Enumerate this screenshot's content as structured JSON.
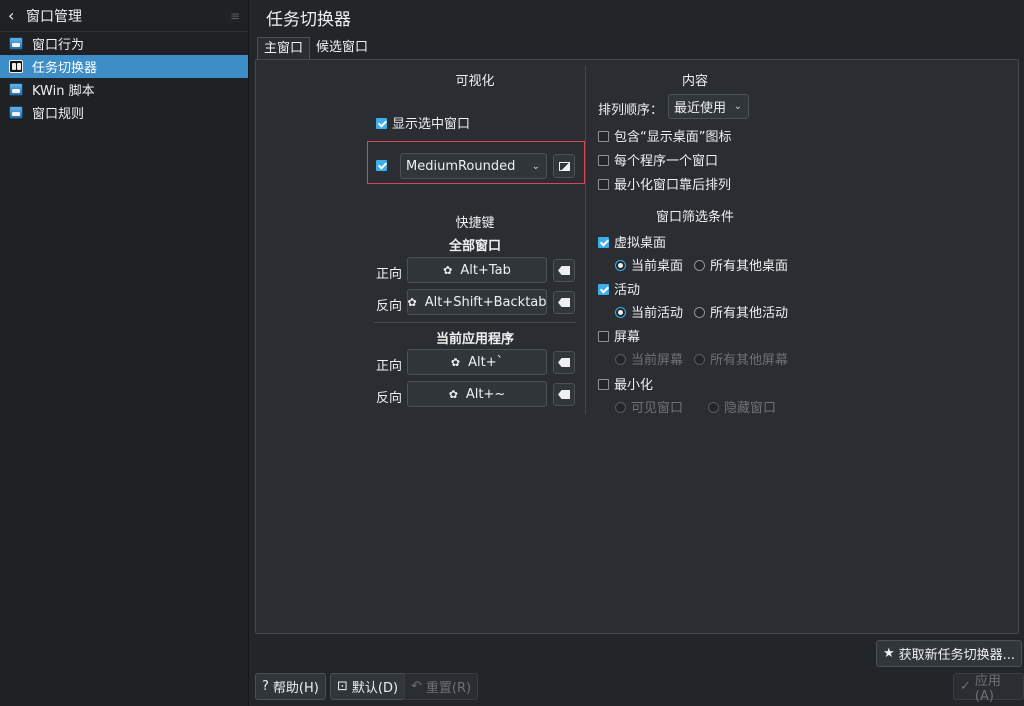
{
  "sidebar": {
    "back_label": "窗口管理",
    "items": [
      {
        "label": "窗口行为",
        "icon": "window-behavior-icon"
      },
      {
        "label": "任务切换器",
        "icon": "task-switcher-icon"
      },
      {
        "label": "KWin 脚本",
        "icon": "kwin-scripts-icon"
      },
      {
        "label": "窗口规则",
        "icon": "window-rules-icon"
      }
    ]
  },
  "header": {
    "title": "任务切换器"
  },
  "tabs": [
    {
      "label": "主窗口"
    },
    {
      "label": "候选窗口"
    }
  ],
  "visualization": {
    "heading": "可视化",
    "show_selected_label": "显示选中窗口",
    "theme_value": "MediumRounded"
  },
  "shortcuts": {
    "heading": "快捷键",
    "all_windows_heading": "全部窗口",
    "current_app_heading": "当前应用程序",
    "forward_label": "正向",
    "reverse_label": "反向",
    "all_forward": "Alt+Tab",
    "all_reverse": "Alt+Shift+Backtab",
    "app_forward": "Alt+`",
    "app_reverse": "Alt+~"
  },
  "content": {
    "heading": "内容",
    "sort_label": "排列顺序：",
    "sort_value": "最近使用",
    "include_desktop": "包含“显示桌面”图标",
    "one_per_app": "每个程序一个窗口",
    "minimized_last": "最小化窗口靠后排列"
  },
  "filter": {
    "heading": "窗口筛选条件",
    "virtual_desktop": "虚拟桌面",
    "current_desktop": "当前桌面",
    "other_desktops": "所有其他桌面",
    "activity": "活动",
    "current_activity": "当前活动",
    "other_activities": "所有其他活动",
    "screen": "屏幕",
    "current_screen": "当前屏幕",
    "other_screens": "所有其他屏幕",
    "minimized": "最小化",
    "visible_windows": "可见窗口",
    "hidden_windows": "隐藏窗口"
  },
  "footer": {
    "get_new": "获取新任务切换器...",
    "help": "帮助(H)",
    "defaults": "默认(D)",
    "reset": "重置(R)",
    "apply": "应用(A)"
  },
  "colors": {
    "accent": "#3daee9",
    "highlight": "#da4453"
  }
}
